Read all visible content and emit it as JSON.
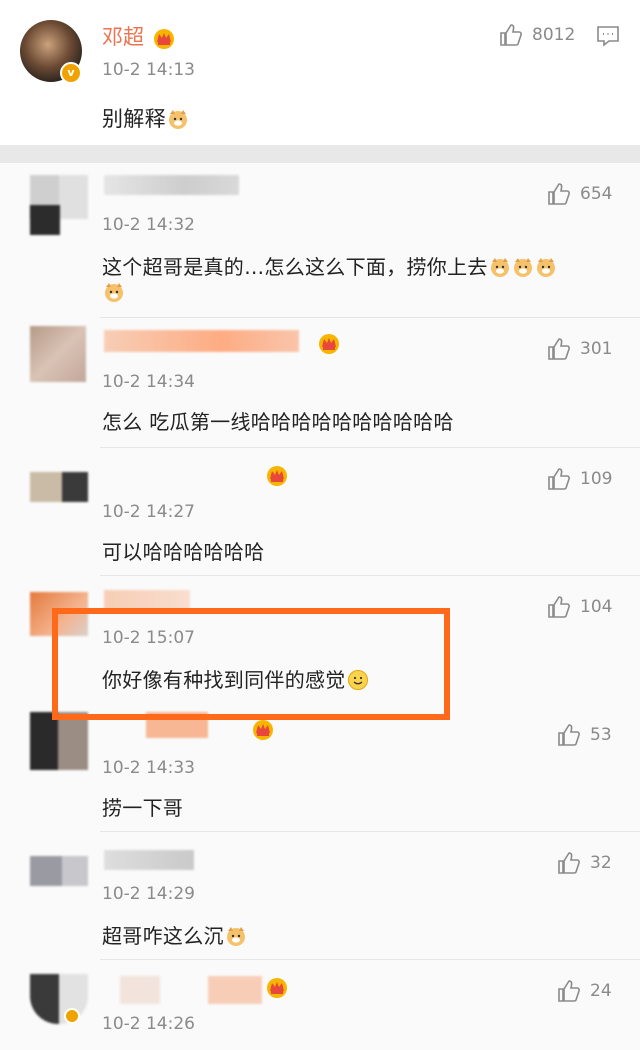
{
  "top_comment": {
    "author": "邓超",
    "time": "10-2 14:13",
    "text": "别解释",
    "likes": "8012",
    "verified_badge": "v"
  },
  "replies": [
    {
      "author": "",
      "time": "10-2 14:32",
      "text": "这个超哥是真的…怎么这么下面，捞你上去",
      "likes": "654"
    },
    {
      "author": "",
      "time": "10-2 14:34",
      "text": "怎么 吃瓜第一线哈哈哈哈哈哈哈哈哈哈",
      "likes": "301"
    },
    {
      "author": "",
      "time": "10-2 14:27",
      "text": "可以哈哈哈哈哈哈",
      "likes": "109"
    },
    {
      "author": "",
      "time": "10-2 15:07",
      "text": "你好像有种找到同伴的感觉",
      "likes": "104"
    },
    {
      "author": "",
      "time": "10-2 14:33",
      "text": "捞一下哥",
      "likes": "53"
    },
    {
      "author": "",
      "time": "10-2 14:29",
      "text": "超哥咋这么沉",
      "likes": "32"
    },
    {
      "author": "",
      "time": "10-2 14:26",
      "text": "",
      "likes": "24"
    }
  ],
  "icons": {
    "like": "thumbs-up-icon",
    "comment": "comment-icon",
    "crown": "crown-icon",
    "emoji_dog": "dog-emoji-icon",
    "emoji_smile": "smile-emoji-icon"
  },
  "colors": {
    "name_orange": "#eb7350",
    "highlight": "#ff6a1a",
    "gray_text": "#8a8a8a"
  }
}
